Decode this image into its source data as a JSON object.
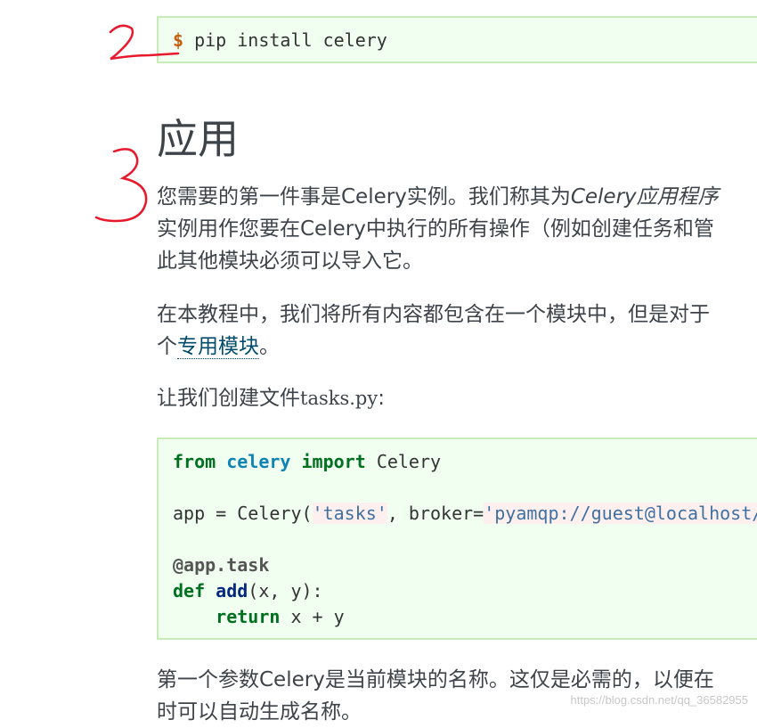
{
  "install": {
    "prompt": "$",
    "command": "pip install celery"
  },
  "heading": "应用",
  "annotations": {
    "mark2": "2",
    "mark3": "3"
  },
  "para1": {
    "line1_a": "您需要的第一件事是Celery实例。我们称其为",
    "line1_b": "Celery应用程序",
    "line2": "实例用作您要在Celery中执行的所有操作（例如创建任务和管",
    "line3": "此其他模块必须可以导入它。"
  },
  "para2": {
    "line1": "在本教程中，我们将所有内容都包含在一个模块中，但是对于",
    "line2_a": "个",
    "line2_link": "专用模块",
    "line2_b": "。"
  },
  "para3": {
    "prefix": "让我们创建文件",
    "filename": "tasks.py",
    "suffix": ":"
  },
  "code": {
    "l1_from": "from",
    "l1_mod": "celery",
    "l1_import": "import",
    "l1_name": "Celery",
    "l2_a": "app = Celery(",
    "l2_str1": "'tasks'",
    "l2_b": ", broker=",
    "l2_str2": "'pyamqp://guest@localhost//'",
    "l3": "@app.task",
    "l4_def": "def",
    "l4_fn": "add",
    "l4_args": "(x, y):",
    "l5_return": "return",
    "l5_expr": "x + y"
  },
  "para4": {
    "line1": "第一个参数Celery是当前模块的名称。这仅是必需的，以便在",
    "line2": "时可以自动生成名称。"
  },
  "watermark": "https://blog.csdn.net/qq_36582955",
  "colors": {
    "code_bg": "#f0fff0",
    "code_border": "#c7ecb8",
    "annotation": "#e8192c"
  }
}
